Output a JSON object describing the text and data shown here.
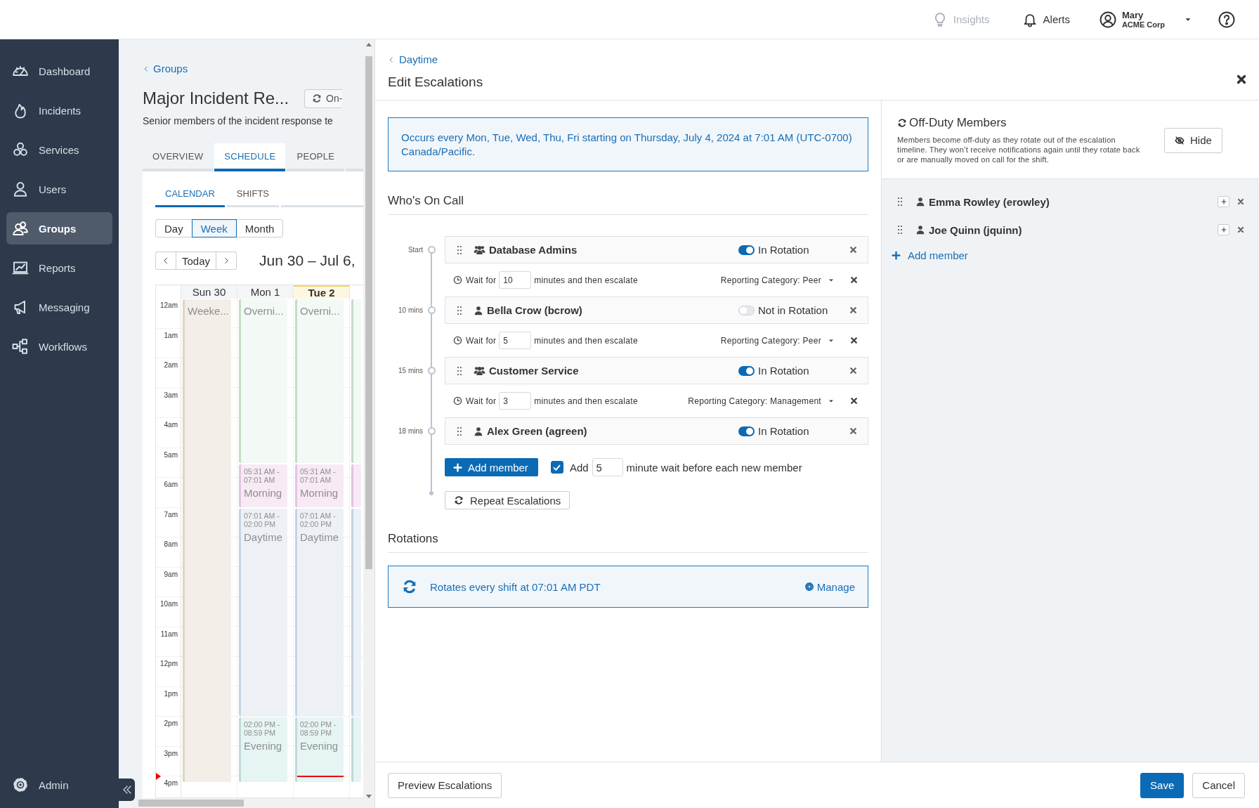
{
  "top_bar": {
    "items": [
      {
        "kind": "insights",
        "label": "Insights",
        "disabled": true
      },
      {
        "kind": "alerts",
        "label": "Alerts",
        "disabled": false
      }
    ],
    "user": {
      "name": "Mary",
      "org": "ACME Corp"
    }
  },
  "sidebar": {
    "items": [
      {
        "label": "Dashboard",
        "selected": false
      },
      {
        "label": "Incidents",
        "selected": false
      },
      {
        "label": "Services",
        "selected": false
      },
      {
        "label": "Users",
        "selected": false
      },
      {
        "label": "Groups",
        "selected": true
      },
      {
        "label": "Reports",
        "selected": false
      },
      {
        "label": "Messaging",
        "selected": false
      },
      {
        "label": "Workflows",
        "selected": false
      }
    ],
    "footer_item": {
      "label": "Admin"
    }
  },
  "group_page": {
    "back_link": "Groups",
    "title": "Major Incident Re...",
    "status_button": "On-",
    "description": "Senior members of the incident response te",
    "tabs": [
      {
        "label": "OVERVIEW",
        "selected": false
      },
      {
        "label": "SCHEDULE",
        "selected": true
      },
      {
        "label": "PEOPLE",
        "selected": false
      }
    ],
    "subtabs": [
      {
        "label": "CALENDAR",
        "selected": true
      },
      {
        "label": "SHIFTS",
        "selected": false
      }
    ],
    "views": [
      {
        "label": "Day",
        "selected": false
      },
      {
        "label": "Week",
        "selected": true
      },
      {
        "label": "Month",
        "selected": false
      }
    ],
    "today_button": "Today",
    "range": "Jun 30 – Jul 6,",
    "calendar": {
      "hours": [
        "12am",
        "1am",
        "2am",
        "3am",
        "4am",
        "5am",
        "6am",
        "7am",
        "8am",
        "9am",
        "10am",
        "11am",
        "12pm",
        "1pm",
        "2pm",
        "3pm",
        "4pm"
      ],
      "days": [
        {
          "label": "Sun 30",
          "today": false,
          "events": [
            {
              "kind": "weekend",
              "title": "Weeke..."
            }
          ]
        },
        {
          "label": "Mon 1",
          "today": false,
          "events": [
            {
              "kind": "overnight",
              "title": "Overni..."
            },
            {
              "kind": "morning",
              "time": "05:31 AM - 07:01 AM",
              "title": "Morning"
            },
            {
              "kind": "daytime",
              "time": "07:01 AM - 02:00 PM",
              "title": "Daytime"
            },
            {
              "kind": "evening",
              "time": "02:00 PM - 08:59 PM",
              "title": "Evening"
            }
          ]
        },
        {
          "label": "Tue 2",
          "today": true,
          "events": [
            {
              "kind": "overnight",
              "title": "Overni..."
            },
            {
              "kind": "morning",
              "time": "05:31 AM - 07:01 AM",
              "title": "Morning"
            },
            {
              "kind": "daytime",
              "time": "07:01 AM - 02:00 PM",
              "title": "Daytime"
            },
            {
              "kind": "evening",
              "time": "02:00 PM - 08:59 PM",
              "title": "Evening"
            }
          ]
        },
        {
          "events": [
            {
              "kind": "overnight"
            },
            {
              "kind": "morning"
            },
            {
              "kind": "daytime"
            },
            {
              "kind": "evening"
            }
          ]
        }
      ]
    }
  },
  "escalations": {
    "back_link": "Daytime",
    "title": "Edit Escalations",
    "schedule_note": "Occurs every Mon, Tue, Wed, Thu, Fri starting on Thursday, July 4, 2024 at 7:01 AM (UTC-0700) Canada/Pacific.",
    "on_call": {
      "heading": "Who's On Call",
      "members": [
        {
          "offset": "Start",
          "kind": "group",
          "name": "Database Admins",
          "in_rotation": true,
          "rotation_label": "In Rotation",
          "wait": {
            "label": "Wait for",
            "minutes": "10",
            "suffix": "minutes and then escalate",
            "category": "Reporting Category: Peer"
          }
        },
        {
          "offset": "10 mins",
          "kind": "user",
          "name": "Bella Crow (bcrow)",
          "in_rotation": false,
          "rotation_label": "Not in Rotation",
          "wait": {
            "label": "Wait for",
            "minutes": "5",
            "suffix": "minutes and then escalate",
            "category": "Reporting Category: Peer"
          }
        },
        {
          "offset": "15 mins",
          "kind": "group",
          "name": "Customer Service",
          "in_rotation": true,
          "rotation_label": "In Rotation",
          "wait": {
            "label": "Wait for",
            "minutes": "3",
            "suffix": "minutes and then escalate",
            "category": "Reporting Category: Management"
          }
        },
        {
          "offset": "18 mins",
          "kind": "user",
          "name": "Alex Green (agreen)",
          "in_rotation": true,
          "rotation_label": "In Rotation"
        }
      ],
      "add_member": "Add member",
      "auto_wait": {
        "checked": true,
        "prefix": "Add",
        "minutes": "5",
        "suffix": "minute wait before each new member"
      },
      "repeat": "Repeat Escalations"
    },
    "rotations": {
      "heading": "Rotations",
      "summary": "Rotates every shift at 07:01 AM PDT",
      "manage": "Manage"
    },
    "off_duty": {
      "title": "Off-Duty Members",
      "description": "Members become off-duty as they rotate out of the escalation timeline. They won’t receive notifications again until they rotate back or are manually moved on call for the shift.",
      "hide": "Hide",
      "members": [
        {
          "kind": "user",
          "name": "Emma Rowley (erowley)"
        },
        {
          "kind": "user",
          "name": "Joe Quinn (jquinn)"
        }
      ],
      "add_member": "Add member"
    },
    "footer": {
      "preview": "Preview Escalations",
      "save": "Save",
      "cancel": "Cancel"
    }
  }
}
